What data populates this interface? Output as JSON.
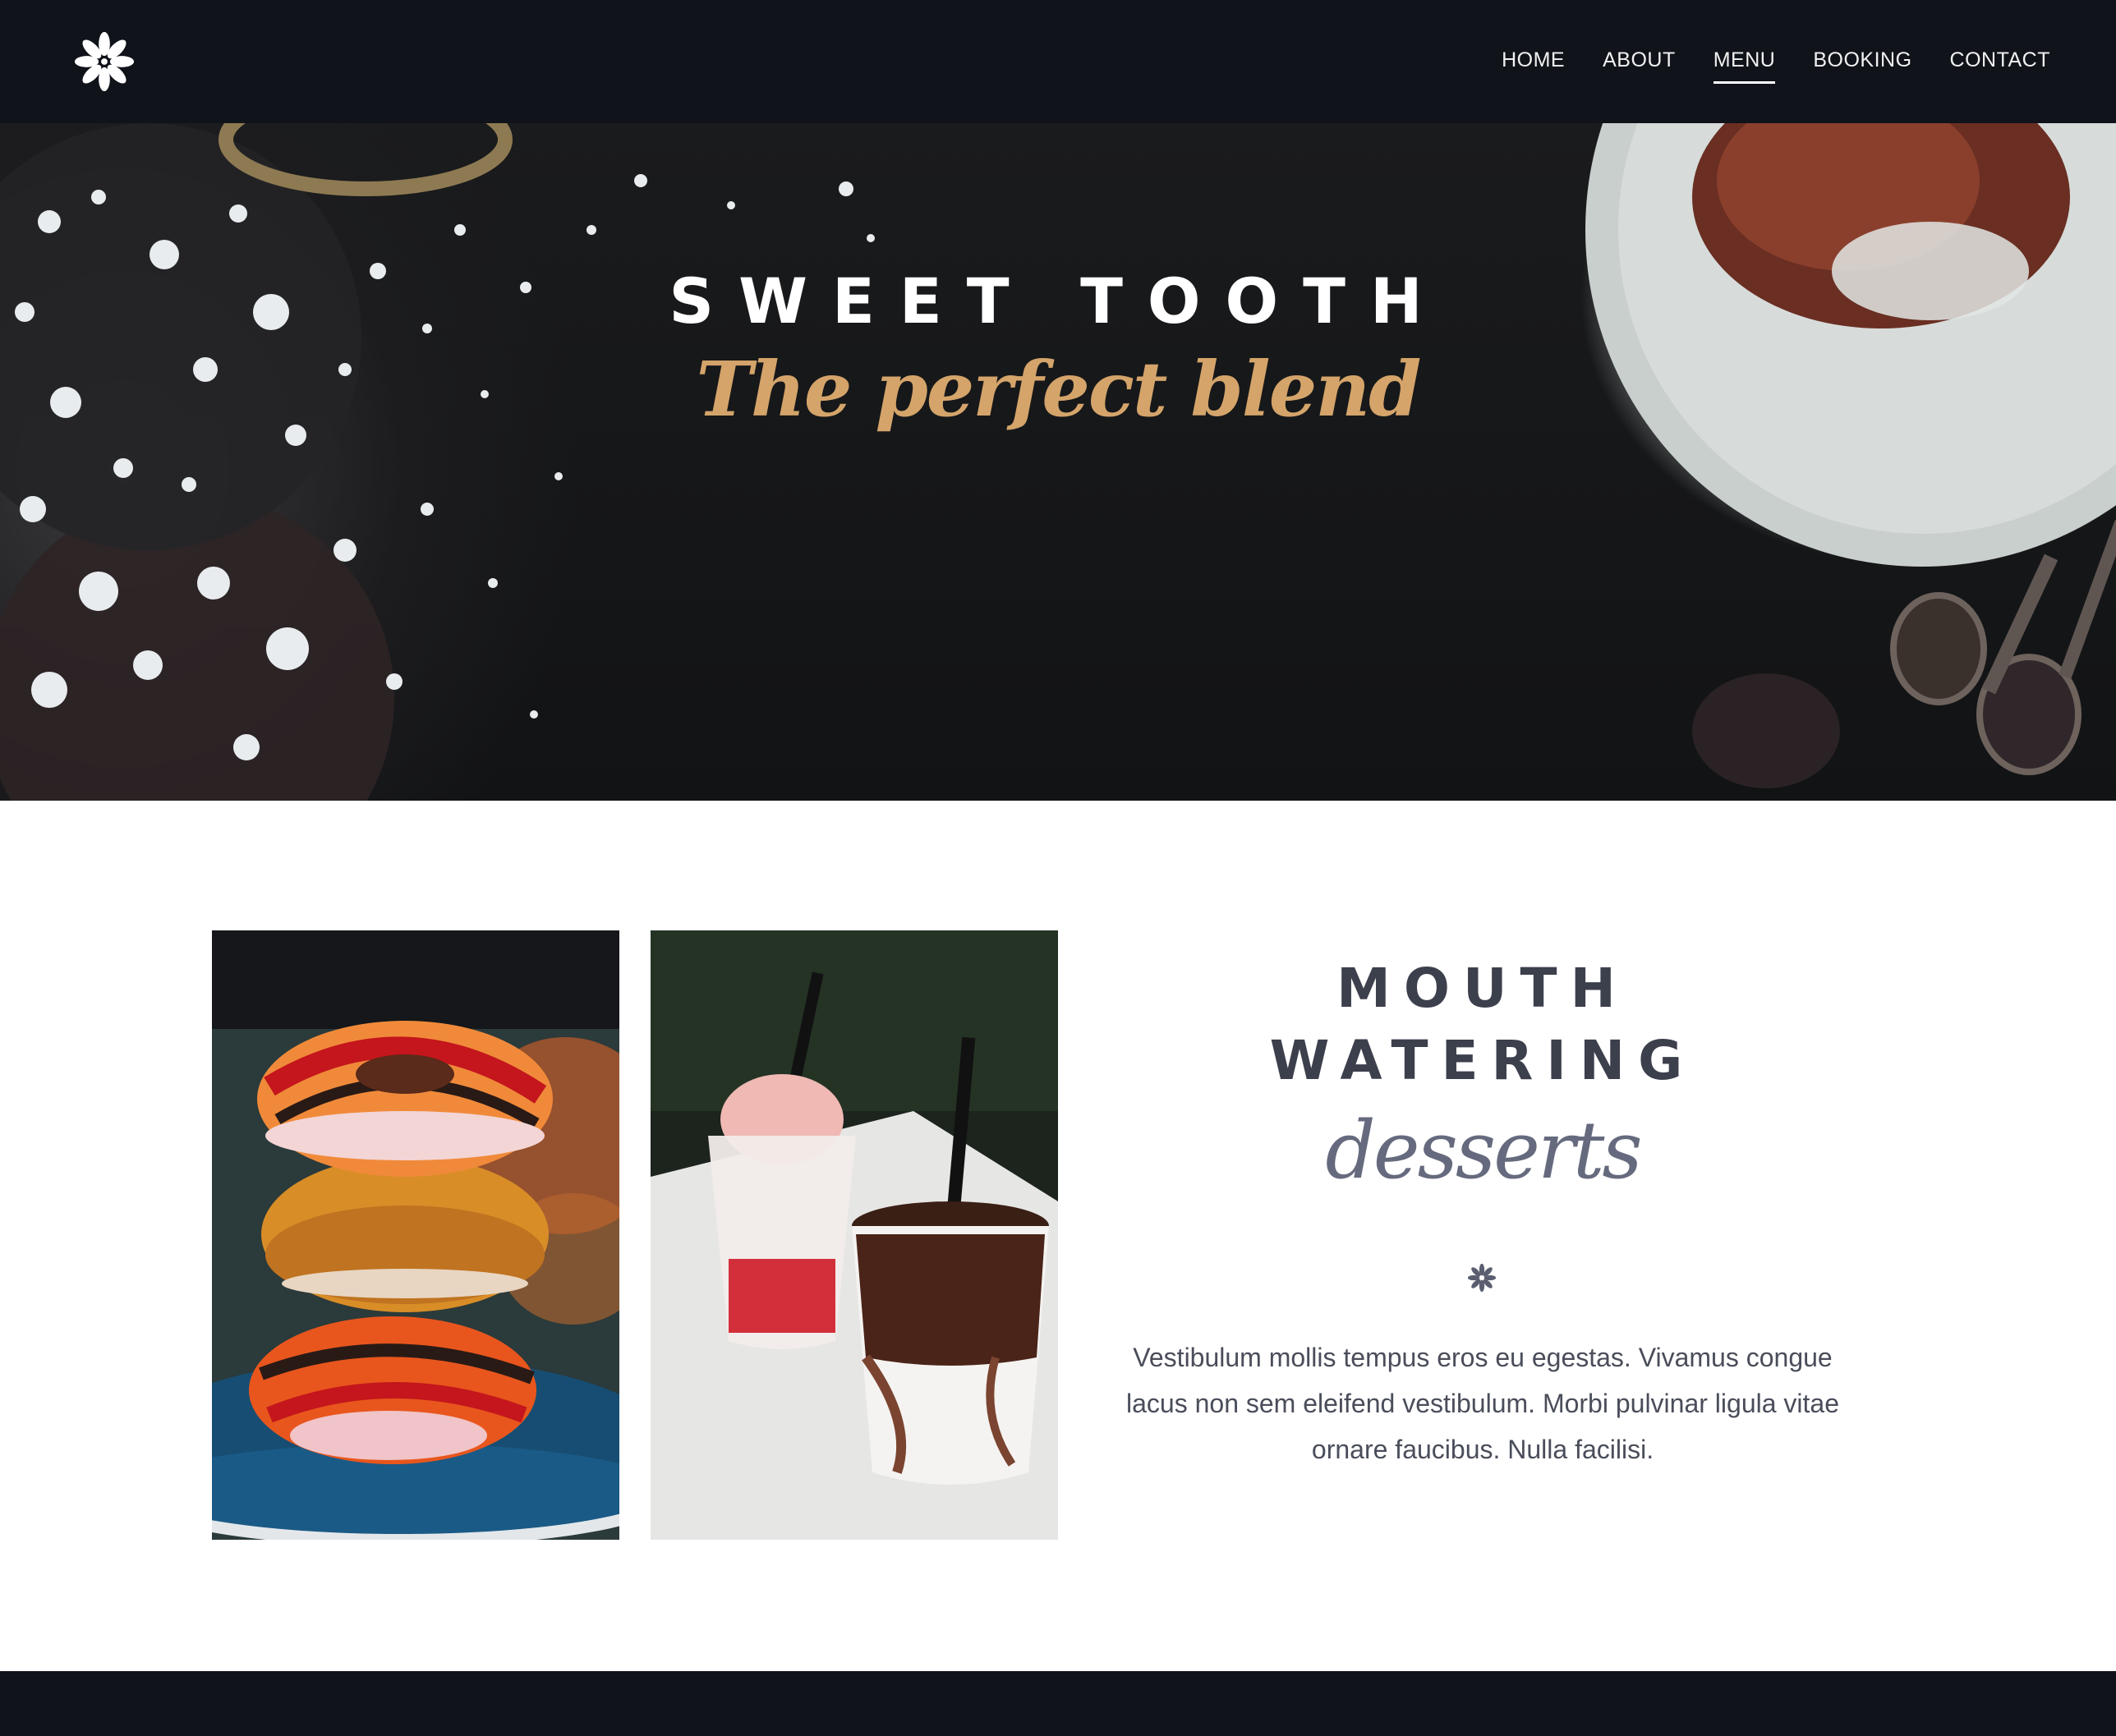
{
  "nav": {
    "logo_icon": "asterisk-flower-icon",
    "items": [
      {
        "label": "HOME",
        "active": false
      },
      {
        "label": "ABOUT",
        "active": false
      },
      {
        "label": "MENU",
        "active": true
      },
      {
        "label": "BOOKING",
        "active": false
      },
      {
        "label": "CONTACT",
        "active": false
      }
    ]
  },
  "hero": {
    "title": "SWEET TOOTH",
    "subtitle": "The perfect blend",
    "subtitle_color": "#d4a46a"
  },
  "section": {
    "headline_line1": "MOUTH",
    "headline_line2": "WATERING",
    "script_word": "desserts",
    "divider_icon": "asterisk-icon",
    "body": "Vestibulum mollis tempus eros eu egestas. Vivamus congue lacus non sem eleifend vestibulum. Morbi pulvinar ligula vitae ornare faucibus. Nulla facilisi.",
    "images": [
      "stacked-bagels-photo",
      "iced-drinks-photo"
    ]
  },
  "colors": {
    "nav_bg": "#10131a",
    "heading": "#3c3f4c",
    "accent_gold": "#d4a46a"
  }
}
